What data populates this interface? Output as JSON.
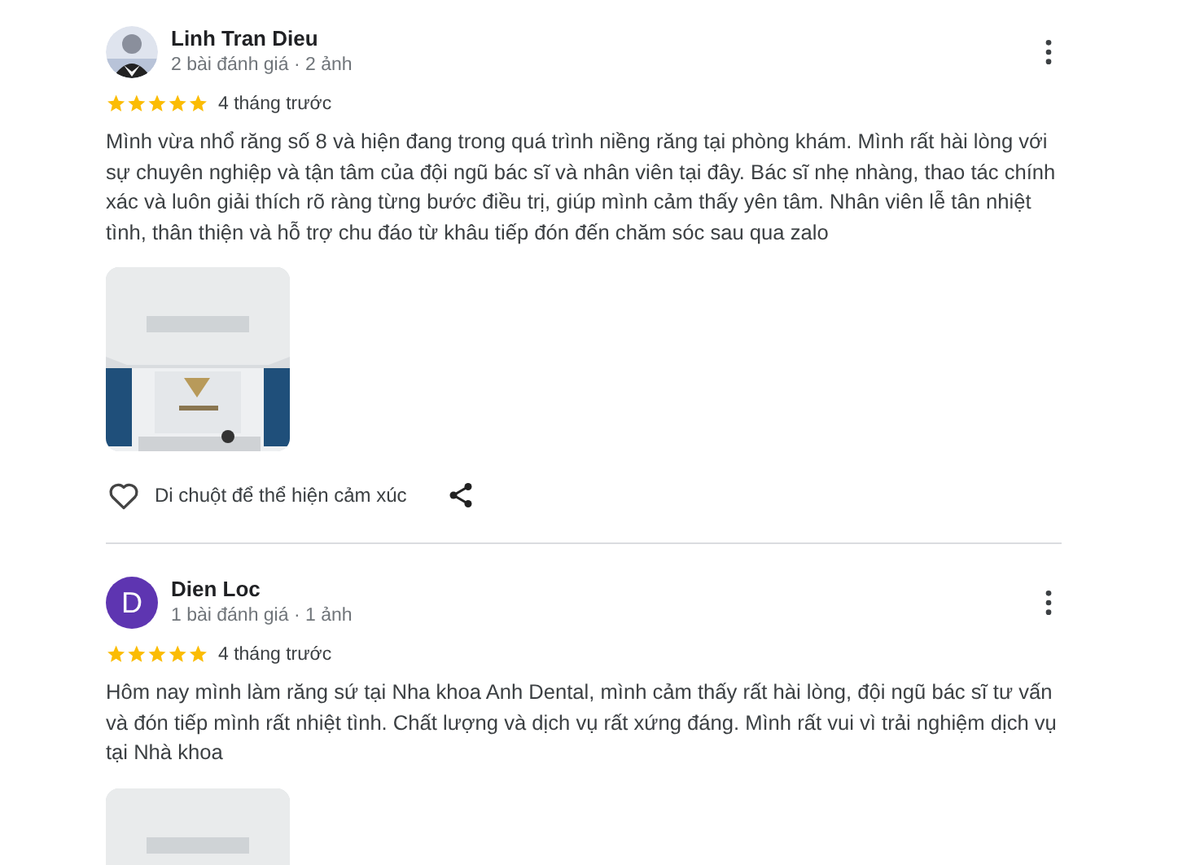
{
  "reviews": [
    {
      "author": "Linh Tran Dieu",
      "avatar": {
        "kind": "picture"
      },
      "meta": "2 bài đánh giá · 2 ảnh",
      "stars": 5,
      "time": "4 tháng trước",
      "text": "Mình vừa nhổ răng số 8 và hiện đang trong quá trình niềng răng tại phòng khám. Mình rất hài lòng với sự chuyên nghiệp và tận tâm của đội ngũ bác sĩ và nhân viên tại đây. Bác sĩ nhẹ nhàng, thao tác chính xác và luôn giải thích rõ ràng từng bước điều trị, giúp mình cảm thấy yên tâm. Nhân viên lễ tân nhiệt tình, thân thiện và hỗ trợ chu đáo từ khâu tiếp đón đến chăm sóc sau qua zalo",
      "photos": [
        {
          "kind": "picture"
        }
      ],
      "reaction_hint": "Di chuột để thể hiện cảm xúc"
    },
    {
      "author": "Dien Loc",
      "avatar": {
        "kind": "letter",
        "letter": "D",
        "color": "#5e35b1"
      },
      "meta": "1 bài đánh giá · 1 ảnh",
      "stars": 5,
      "time": "4 tháng trước",
      "text": "Hôm nay mình làm răng sứ tại Nha khoa Anh Dental, mình cảm thấy rất hài lòng, đội ngũ bác sĩ tư vấn và đón tiếp mình rất nhiệt tình. Chất lượng và dịch vụ rất xứng đáng. Mình rất vui vì trải nghiệm dịch vụ tại Nhà khoa",
      "photos": [
        {
          "kind": "picture"
        }
      ]
    }
  ]
}
